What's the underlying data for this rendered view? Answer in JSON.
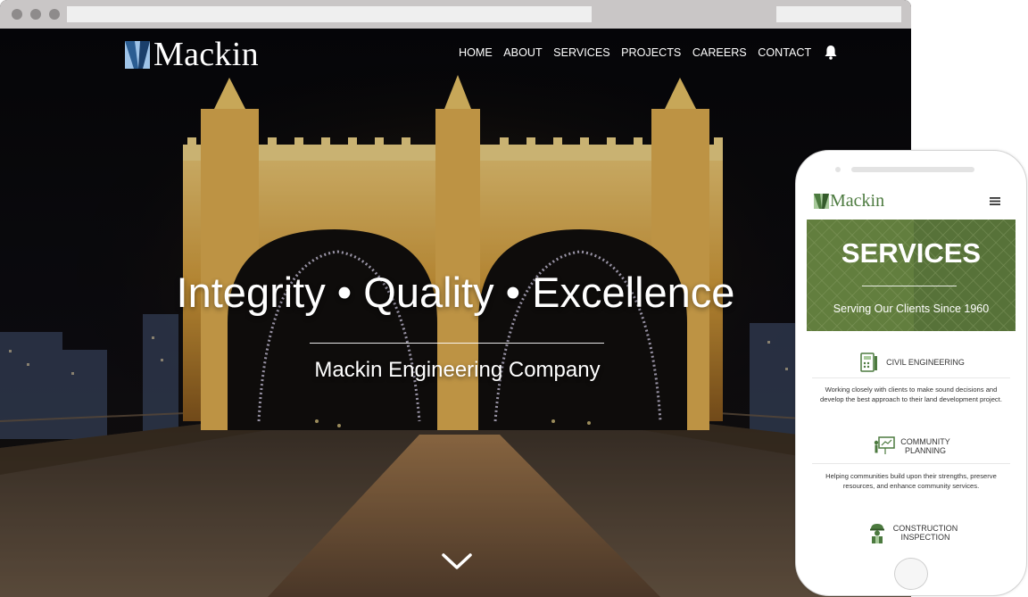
{
  "desktop": {
    "logo_text": "Mackin",
    "nav": [
      {
        "label": "HOME"
      },
      {
        "label": "ABOUT"
      },
      {
        "label": "SERVICES"
      },
      {
        "label": "PROJECTS"
      },
      {
        "label": "CAREERS"
      },
      {
        "label": "CONTACT"
      }
    ],
    "notification_icon": "bell-icon",
    "hero": {
      "headline": "Integrity • Quality • Excellence",
      "subheadline": "Mackin Engineering Company",
      "scroll_icon": "chevron-down-icon"
    }
  },
  "mobile": {
    "logo_text": "Mackin",
    "menu_icon": "hamburger-menu-icon",
    "banner": {
      "title": "SERVICES",
      "tagline": "Serving Our Clients Since 1960"
    },
    "services": [
      {
        "icon": "civil-engineering-icon",
        "name_lines": [
          "CIVIL ENGINEERING"
        ],
        "description_lines": [
          "Working closely with clients to make sound decisions and",
          "develop the best approach to their land development project."
        ]
      },
      {
        "icon": "community-planning-icon",
        "name_lines": [
          "COMMUNITY",
          "PLANNING"
        ],
        "description_lines": [
          "Helping communities build upon their strengths, preserve",
          "resources, and enhance community services."
        ]
      },
      {
        "icon": "construction-inspection-icon",
        "name_lines": [
          "CONSTRUCTION",
          "INSPECTION"
        ],
        "description_lines": []
      }
    ]
  },
  "colors": {
    "brand_green": "#4c7a3f",
    "logo_blue": "#3f6fa3",
    "bridge_gold": "#d9a03b",
    "frame_gray": "#c9c6c6"
  }
}
